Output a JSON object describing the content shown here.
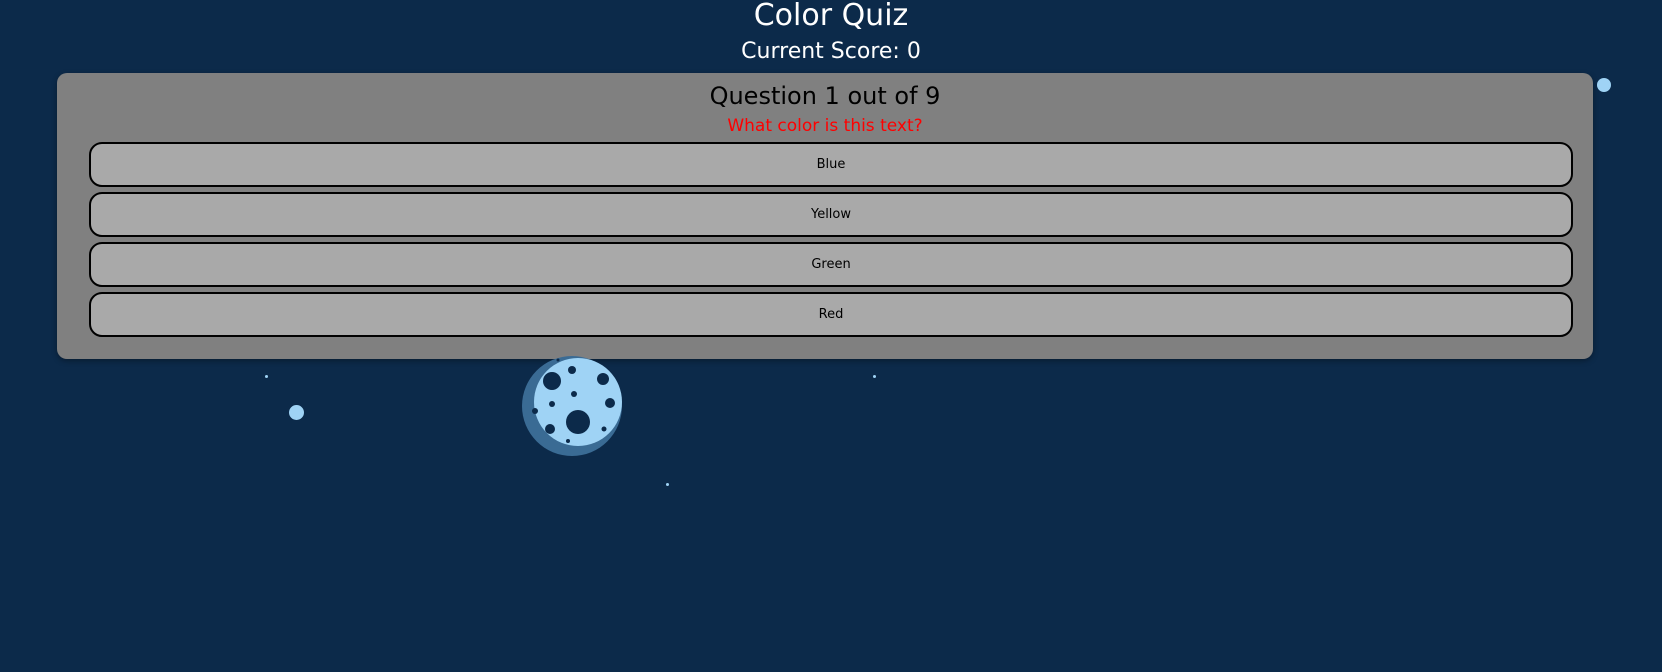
{
  "header": {
    "title": "Color Quiz",
    "score_text": "Current Score: 0"
  },
  "quiz": {
    "question_counter": "Question 1 out of 9",
    "prompt": "What color is this text?",
    "prompt_color": "#ff0000",
    "answers": [
      {
        "label": "Blue"
      },
      {
        "label": "Yellow"
      },
      {
        "label": "Green"
      },
      {
        "label": "Red"
      }
    ]
  },
  "colors": {
    "background": "#0c2a4a",
    "card": "#808080",
    "answer_button": "#a9a9a9",
    "moon": "#9fd3f5",
    "moon_shadow": "#3a6b94",
    "star": "#9fd3f5"
  },
  "decorations": {
    "moon_icon": "moon-icon",
    "star_icon": "star-icon"
  }
}
